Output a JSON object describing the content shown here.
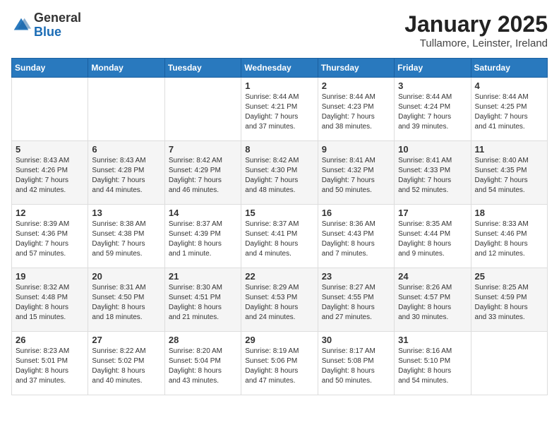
{
  "logo": {
    "general": "General",
    "blue": "Blue"
  },
  "title": "January 2025",
  "location": "Tullamore, Leinster, Ireland",
  "days_of_week": [
    "Sunday",
    "Monday",
    "Tuesday",
    "Wednesday",
    "Thursday",
    "Friday",
    "Saturday"
  ],
  "weeks": [
    [
      {
        "day": "",
        "info": ""
      },
      {
        "day": "",
        "info": ""
      },
      {
        "day": "",
        "info": ""
      },
      {
        "day": "1",
        "info": "Sunrise: 8:44 AM\nSunset: 4:21 PM\nDaylight: 7 hours\nand 37 minutes."
      },
      {
        "day": "2",
        "info": "Sunrise: 8:44 AM\nSunset: 4:23 PM\nDaylight: 7 hours\nand 38 minutes."
      },
      {
        "day": "3",
        "info": "Sunrise: 8:44 AM\nSunset: 4:24 PM\nDaylight: 7 hours\nand 39 minutes."
      },
      {
        "day": "4",
        "info": "Sunrise: 8:44 AM\nSunset: 4:25 PM\nDaylight: 7 hours\nand 41 minutes."
      }
    ],
    [
      {
        "day": "5",
        "info": "Sunrise: 8:43 AM\nSunset: 4:26 PM\nDaylight: 7 hours\nand 42 minutes."
      },
      {
        "day": "6",
        "info": "Sunrise: 8:43 AM\nSunset: 4:28 PM\nDaylight: 7 hours\nand 44 minutes."
      },
      {
        "day": "7",
        "info": "Sunrise: 8:42 AM\nSunset: 4:29 PM\nDaylight: 7 hours\nand 46 minutes."
      },
      {
        "day": "8",
        "info": "Sunrise: 8:42 AM\nSunset: 4:30 PM\nDaylight: 7 hours\nand 48 minutes."
      },
      {
        "day": "9",
        "info": "Sunrise: 8:41 AM\nSunset: 4:32 PM\nDaylight: 7 hours\nand 50 minutes."
      },
      {
        "day": "10",
        "info": "Sunrise: 8:41 AM\nSunset: 4:33 PM\nDaylight: 7 hours\nand 52 minutes."
      },
      {
        "day": "11",
        "info": "Sunrise: 8:40 AM\nSunset: 4:35 PM\nDaylight: 7 hours\nand 54 minutes."
      }
    ],
    [
      {
        "day": "12",
        "info": "Sunrise: 8:39 AM\nSunset: 4:36 PM\nDaylight: 7 hours\nand 57 minutes."
      },
      {
        "day": "13",
        "info": "Sunrise: 8:38 AM\nSunset: 4:38 PM\nDaylight: 7 hours\nand 59 minutes."
      },
      {
        "day": "14",
        "info": "Sunrise: 8:37 AM\nSunset: 4:39 PM\nDaylight: 8 hours\nand 1 minute."
      },
      {
        "day": "15",
        "info": "Sunrise: 8:37 AM\nSunset: 4:41 PM\nDaylight: 8 hours\nand 4 minutes."
      },
      {
        "day": "16",
        "info": "Sunrise: 8:36 AM\nSunset: 4:43 PM\nDaylight: 8 hours\nand 7 minutes."
      },
      {
        "day": "17",
        "info": "Sunrise: 8:35 AM\nSunset: 4:44 PM\nDaylight: 8 hours\nand 9 minutes."
      },
      {
        "day": "18",
        "info": "Sunrise: 8:33 AM\nSunset: 4:46 PM\nDaylight: 8 hours\nand 12 minutes."
      }
    ],
    [
      {
        "day": "19",
        "info": "Sunrise: 8:32 AM\nSunset: 4:48 PM\nDaylight: 8 hours\nand 15 minutes."
      },
      {
        "day": "20",
        "info": "Sunrise: 8:31 AM\nSunset: 4:50 PM\nDaylight: 8 hours\nand 18 minutes."
      },
      {
        "day": "21",
        "info": "Sunrise: 8:30 AM\nSunset: 4:51 PM\nDaylight: 8 hours\nand 21 minutes."
      },
      {
        "day": "22",
        "info": "Sunrise: 8:29 AM\nSunset: 4:53 PM\nDaylight: 8 hours\nand 24 minutes."
      },
      {
        "day": "23",
        "info": "Sunrise: 8:27 AM\nSunset: 4:55 PM\nDaylight: 8 hours\nand 27 minutes."
      },
      {
        "day": "24",
        "info": "Sunrise: 8:26 AM\nSunset: 4:57 PM\nDaylight: 8 hours\nand 30 minutes."
      },
      {
        "day": "25",
        "info": "Sunrise: 8:25 AM\nSunset: 4:59 PM\nDaylight: 8 hours\nand 33 minutes."
      }
    ],
    [
      {
        "day": "26",
        "info": "Sunrise: 8:23 AM\nSunset: 5:01 PM\nDaylight: 8 hours\nand 37 minutes."
      },
      {
        "day": "27",
        "info": "Sunrise: 8:22 AM\nSunset: 5:02 PM\nDaylight: 8 hours\nand 40 minutes."
      },
      {
        "day": "28",
        "info": "Sunrise: 8:20 AM\nSunset: 5:04 PM\nDaylight: 8 hours\nand 43 minutes."
      },
      {
        "day": "29",
        "info": "Sunrise: 8:19 AM\nSunset: 5:06 PM\nDaylight: 8 hours\nand 47 minutes."
      },
      {
        "day": "30",
        "info": "Sunrise: 8:17 AM\nSunset: 5:08 PM\nDaylight: 8 hours\nand 50 minutes."
      },
      {
        "day": "31",
        "info": "Sunrise: 8:16 AM\nSunset: 5:10 PM\nDaylight: 8 hours\nand 54 minutes."
      },
      {
        "day": "",
        "info": ""
      }
    ]
  ]
}
